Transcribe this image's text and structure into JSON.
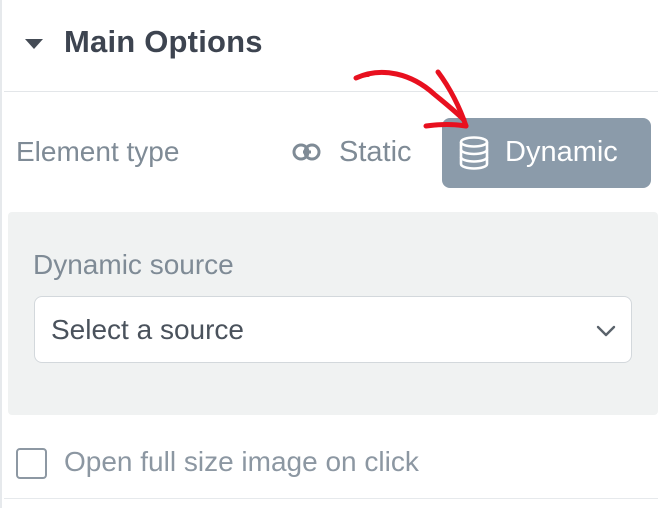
{
  "section": {
    "title": "Main Options"
  },
  "element_type": {
    "label": "Element type",
    "options": [
      {
        "label": "Static",
        "icon": "link-icon",
        "selected": false
      },
      {
        "label": "Dynamic",
        "icon": "database-icon",
        "selected": true
      }
    ]
  },
  "dynamic_source": {
    "label": "Dynamic source",
    "selected_value": "Select a source"
  },
  "open_full_size": {
    "label": "Open full size image on click",
    "checked": false
  },
  "colors": {
    "selected_bg": "#8b9baa",
    "muted_text": "#7f8b96",
    "annotation_arrow": "#e8101f"
  }
}
